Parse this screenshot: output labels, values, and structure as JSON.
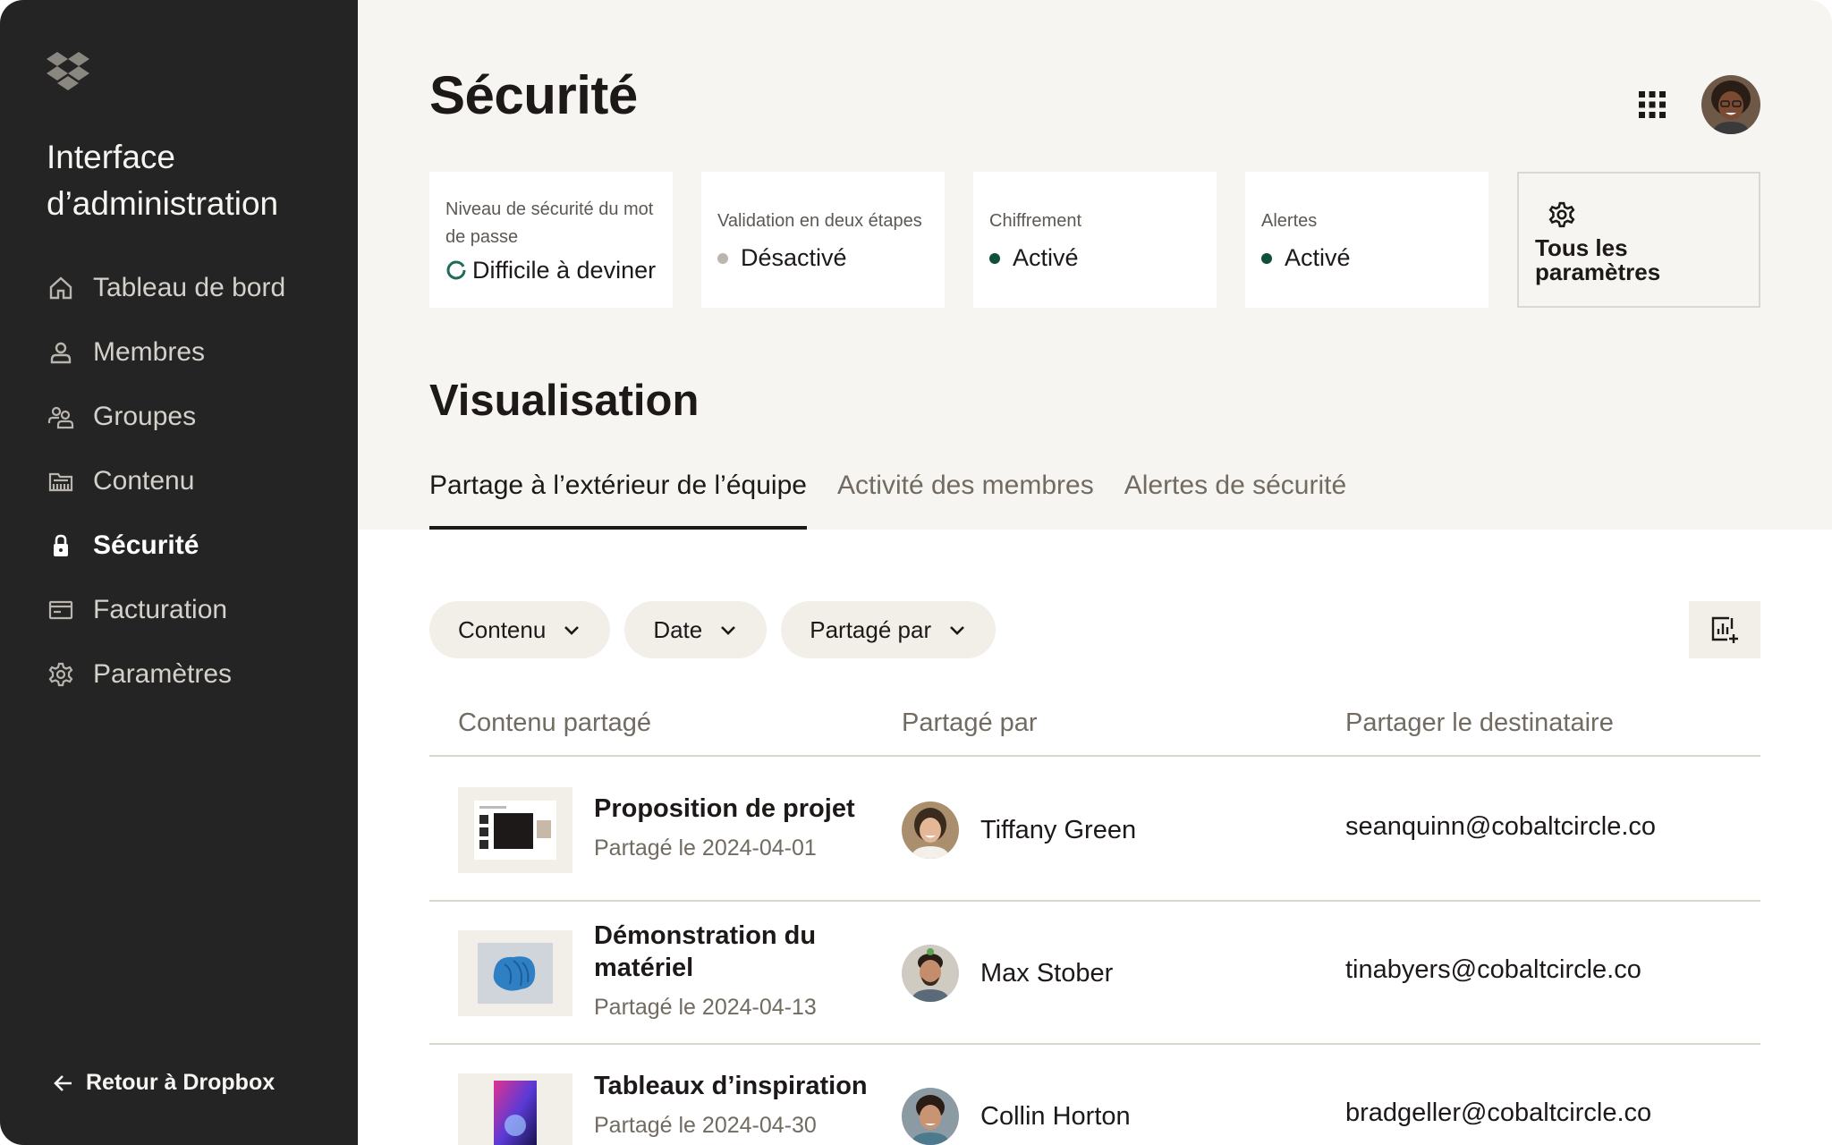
{
  "sidebar": {
    "title": "Interface d’administration",
    "items": [
      {
        "label": "Tableau de bord",
        "icon": "home-icon"
      },
      {
        "label": "Membres",
        "icon": "person-icon"
      },
      {
        "label": "Groupes",
        "icon": "group-icon"
      },
      {
        "label": "Contenu",
        "icon": "folder-icon"
      },
      {
        "label": "Sécurité",
        "icon": "lock-icon",
        "active": true
      },
      {
        "label": "Facturation",
        "icon": "billing-icon"
      },
      {
        "label": "Paramètres",
        "icon": "gear-icon"
      }
    ],
    "back_label": "Retour à Dropbox"
  },
  "header": {
    "title": "Sécurité"
  },
  "cards": [
    {
      "label": "Niveau de sécurité du mot de passe",
      "value": "Difficile à deviner"
    },
    {
      "label": "Validation en deux étapes",
      "value": "Désactivé",
      "status_color": "#bbb5ae"
    },
    {
      "label": "Chiffrement",
      "value": "Activé",
      "status_color": "#0f503c"
    },
    {
      "label": "Alertes",
      "value": "Activé",
      "status_color": "#0f503c"
    }
  ],
  "settings_card": {
    "label": "Tous les paramètres"
  },
  "visualisation": {
    "title": "Visualisation",
    "tabs": [
      {
        "label": "Partage à l’extérieur de l’équipe",
        "active": true
      },
      {
        "label": "Activité des membres"
      },
      {
        "label": "Alertes de sécurité"
      }
    ]
  },
  "filters": [
    "Contenu",
    "Date",
    "Partagé par"
  ],
  "table": {
    "columns": [
      "Contenu partagé",
      "Partagé par",
      "Partager le destinataire"
    ],
    "rows": [
      {
        "name": "Proposition de projet",
        "date": "Partagé le 2024-04-01",
        "shared_by": "Tiffany Green",
        "recipient": "seanquinn@cobaltcircle.co"
      },
      {
        "name": "Démonstration du matériel",
        "date": "Partagé le 2024-04-13",
        "shared_by": "Max Stober",
        "recipient": "tinabyers@cobaltcircle.co"
      },
      {
        "name": "Tableaux d’inspiration",
        "date": "Partagé le 2024-04-30",
        "shared_by": "Collin Horton",
        "recipient": "bradgeller@cobaltcircle.co"
      }
    ]
  },
  "colors": {
    "sidebar_bg": "#242424",
    "page_bg": "#f7f5f2",
    "active_green": "#0f503c",
    "chip_bg": "#f2eee8"
  }
}
